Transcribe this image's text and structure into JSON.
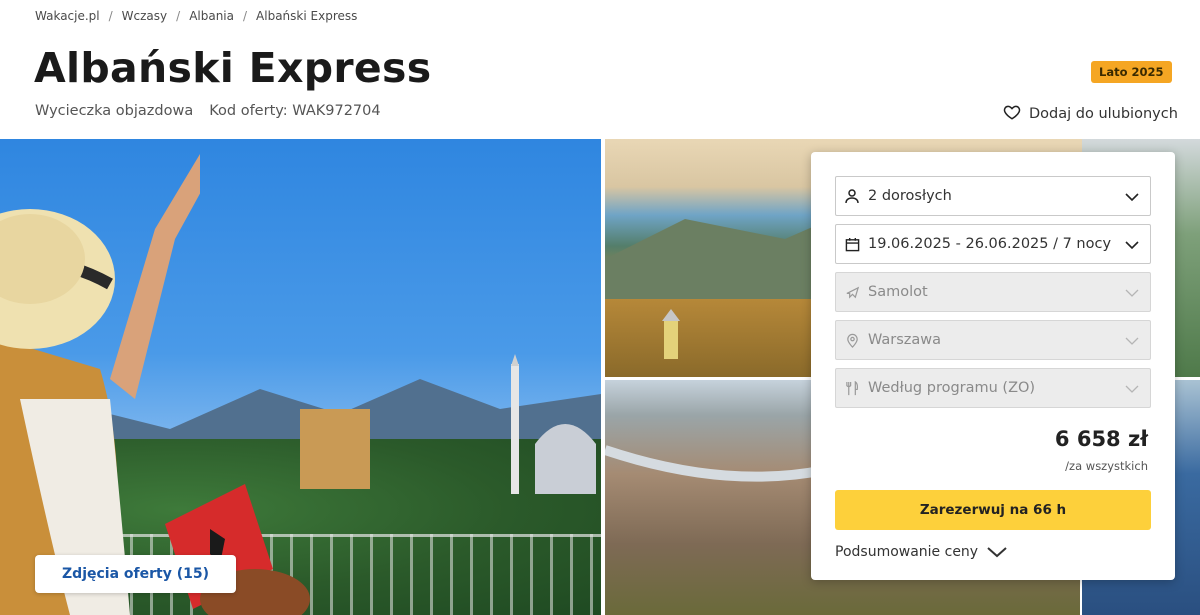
{
  "breadcrumb": [
    "Wakacje.pl",
    "Wczasy",
    "Albania",
    "Albański Express"
  ],
  "header": {
    "title": "Albański Express",
    "trip_type": "Wycieczka objazdowa",
    "offer_code": "Kod oferty: WAK972704",
    "season_badge": "Lato 2025",
    "favorite_label": "Dodaj do ulubionych"
  },
  "gallery": {
    "photos_button": "Zdjęcia oferty (15)"
  },
  "booking": {
    "travelers": "2 dorosłych",
    "dates": "19.06.2025 - 26.06.2025 / 7 nocy",
    "transport": "Samolot",
    "departure": "Warszawa",
    "board": "Według programu (ZO)",
    "price": "6 658 zł",
    "price_note": "/za wszystkich",
    "book_button": "Zarezerwuj na 66 h",
    "summary_label": "Podsumowanie ceny"
  },
  "icons": {
    "favorite": "heart-icon",
    "travelers": "person-icon",
    "dates": "calendar-icon",
    "transport": "plane-icon",
    "departure": "location-pin-icon",
    "board": "cutlery-icon",
    "dropdown": "chevron-down-icon"
  },
  "colors": {
    "badge": "#f5a623",
    "book_button": "#fdd03b",
    "photos_button_text": "#1b57a6"
  }
}
